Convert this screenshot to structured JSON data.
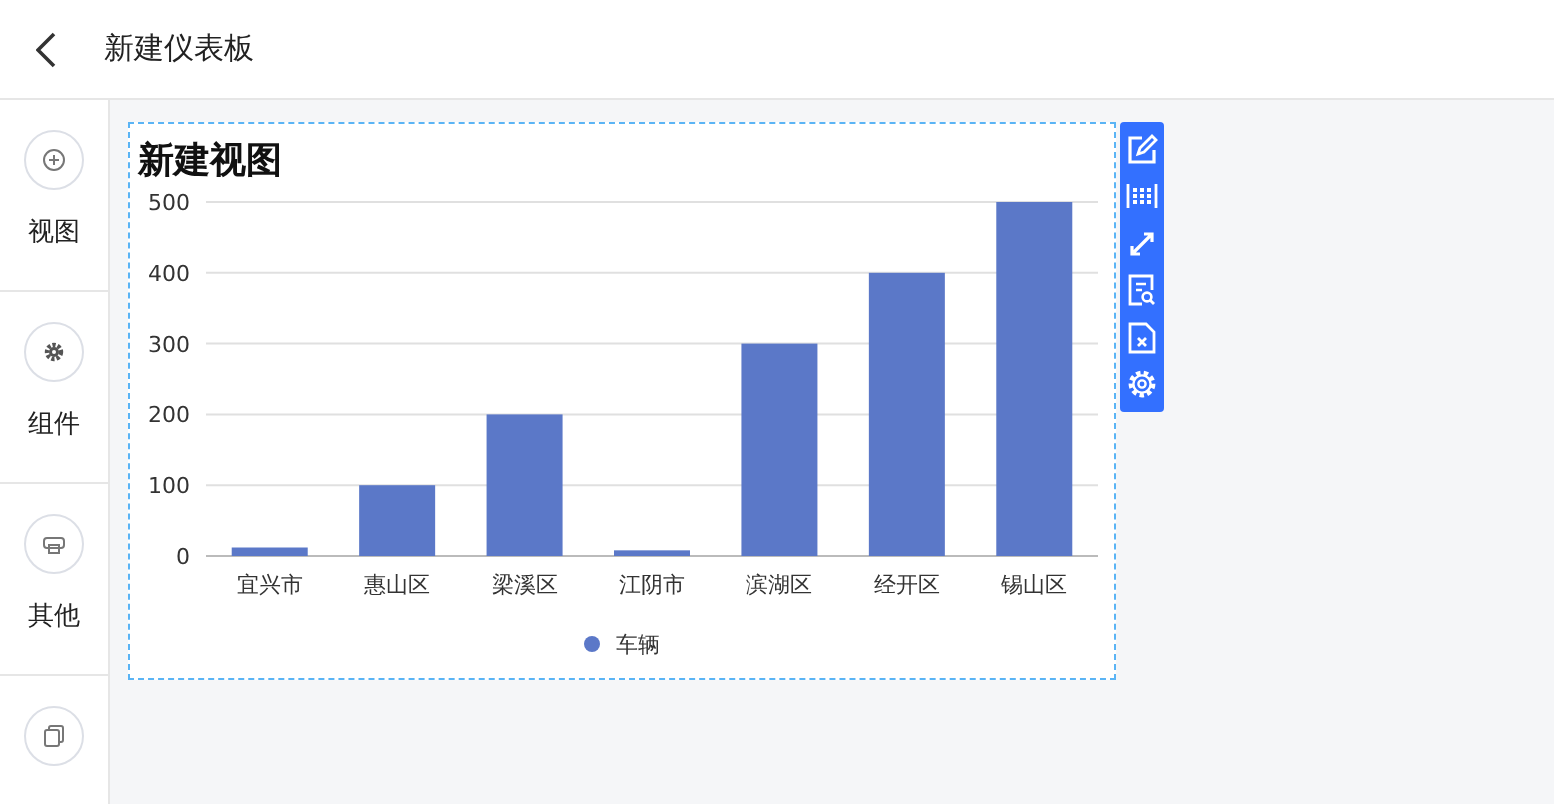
{
  "header": {
    "title": "新建仪表板"
  },
  "sidebar": {
    "items": [
      {
        "kind": "add",
        "label": "视图"
      },
      {
        "kind": "gear",
        "label": "组件"
      },
      {
        "kind": "other",
        "label": "其他"
      },
      {
        "kind": "copy"
      }
    ]
  },
  "card": {
    "title": "新建视图",
    "chart_data": {
      "type": "bar",
      "categories": [
        "宜兴市",
        "惠山区",
        "梁溪区",
        "江阴市",
        "滨湖区",
        "经开区",
        "锡山区"
      ],
      "series": [
        {
          "name": "车辆",
          "color": "#5b78c8",
          "values": [
            12,
            100,
            200,
            8,
            300,
            400,
            500
          ]
        }
      ],
      "grid": true,
      "ylim": [
        0,
        500
      ],
      "yticks": [
        0,
        100,
        200,
        300,
        400,
        500
      ]
    }
  },
  "toolbar": {
    "items": [
      {
        "kind": "edit"
      },
      {
        "kind": "grid"
      },
      {
        "kind": "expand"
      },
      {
        "kind": "search-doc"
      },
      {
        "kind": "delete-doc"
      },
      {
        "kind": "settings"
      }
    ]
  }
}
